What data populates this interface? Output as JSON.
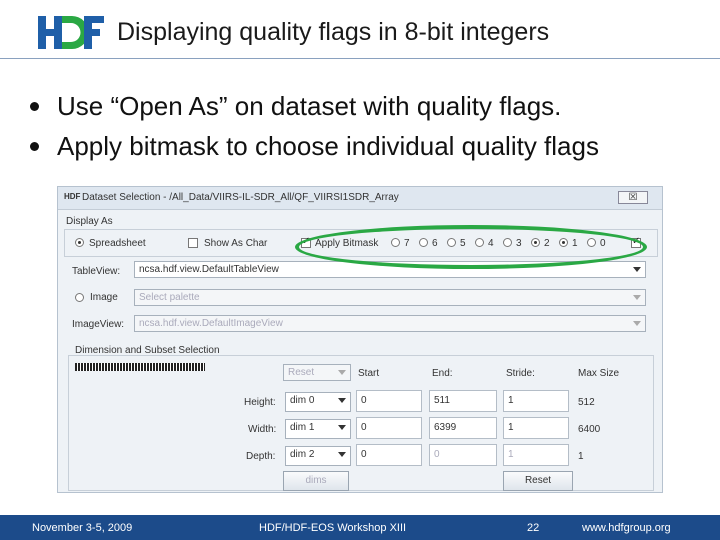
{
  "logo": {
    "text": "HDF",
    "colors": {
      "h": "#1f5fa8",
      "d": "#2aa844",
      "f": "#1f5fa8"
    }
  },
  "title": "Displaying quality flags in 8-bit integers",
  "bullets": [
    "Use “Open As” on dataset with quality flags.",
    "Apply bitmask to choose individual quality flags"
  ],
  "dialog": {
    "title": "Dataset Selection - /All_Data/VIIRS-IL-SDR_All/QF_VIIRSI1SDR_Array",
    "close_label": "☒",
    "display_as": {
      "label": "Display As",
      "spreadsheet": "Spreadsheet",
      "show_as_char": "Show As Char",
      "apply_bitmask": "Apply Bitmask",
      "bits": [
        {
          "label": "7",
          "on": false
        },
        {
          "label": "6",
          "on": false
        },
        {
          "label": "5",
          "on": false
        },
        {
          "label": "4",
          "on": false
        },
        {
          "label": "3",
          "on": false
        },
        {
          "label": "2",
          "on": true
        },
        {
          "label": "1",
          "on": true
        },
        {
          "label": "0",
          "on": false
        }
      ]
    },
    "tableview": {
      "label": "TableView:",
      "value": "ncsa.hdf.view.DefaultTableView"
    },
    "image": {
      "label": "Image",
      "palette_placeholder": "Select palette"
    },
    "imageview": {
      "label": "ImageView:",
      "value": "ncsa.hdf.view.DefaultImageView"
    },
    "dimension": {
      "label": "Dimension and Subset Selection",
      "reset_top": "Reset",
      "headers": {
        "start": "Start",
        "end": "End:",
        "stride": "Stride:",
        "max": "Max Size"
      },
      "rows": [
        {
          "label": "Height:",
          "dim": "dim 0",
          "start": "0",
          "end": "511",
          "stride": "1",
          "max": "512"
        },
        {
          "label": "Width:",
          "dim": "dim 1",
          "start": "0",
          "end": "6399",
          "stride": "1",
          "max": "6400"
        },
        {
          "label": "Depth:",
          "dim": "dim 2",
          "start": "0",
          "end": "0",
          "stride": "1",
          "max": "1"
        }
      ],
      "dims_button": "dims",
      "reset_button": "Reset"
    }
  },
  "footer": {
    "date": "November 3-5, 2009",
    "event": "HDF/HDF-EOS Workshop XIII",
    "page": "22",
    "url": "www.hdfgroup.org"
  }
}
